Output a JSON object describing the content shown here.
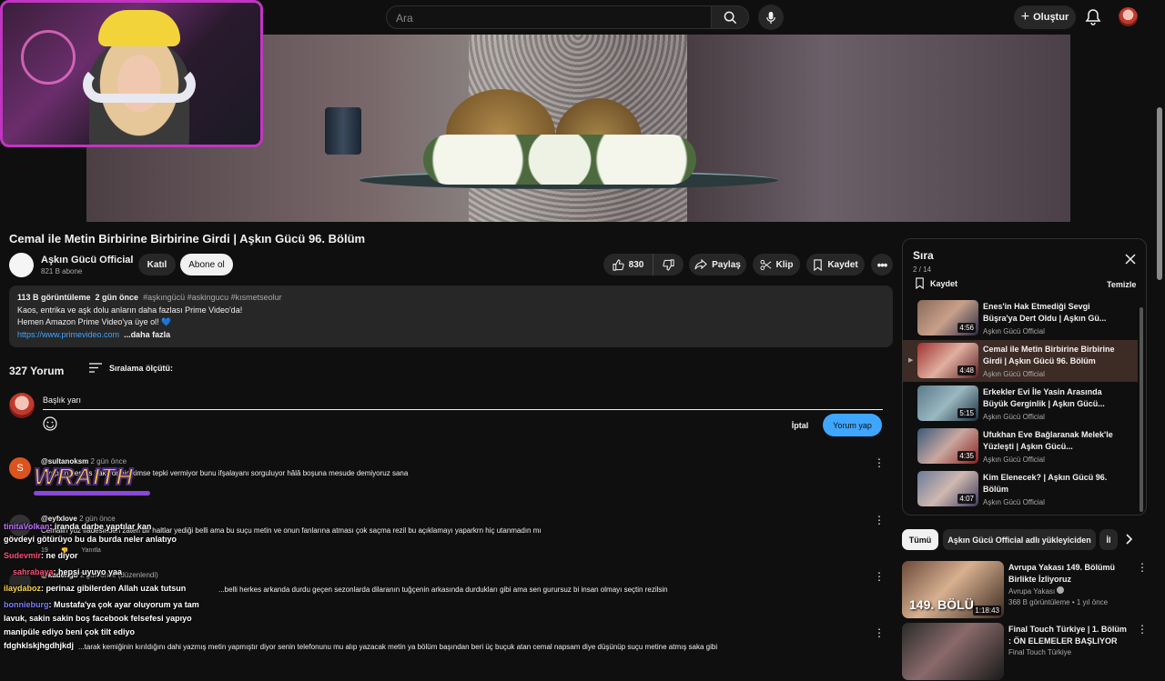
{
  "header": {
    "search_placeholder": "Ara",
    "create_label": "Oluştur"
  },
  "video": {
    "title": "Cemal ile Metin Birbirine Birbirine Girdi | Aşkın Gücü 96. Bölüm",
    "channel_name": "Aşkın Gücü Official",
    "subscribers": "821 B abone",
    "join_label": "Katıl",
    "subscribe_label": "Abone ol",
    "likes": "830",
    "share_label": "Paylaş",
    "clip_label": "Klip",
    "save_label": "Kaydet"
  },
  "description": {
    "views": "113 B görüntüleme",
    "date": "2 gün önce",
    "tags": "#aşkıngücü #askingucu #kısmetseolur",
    "line1": "Kaos, entrika ve aşk dolu anların daha fazlası Prime Video'da!",
    "line2": "Hemen Amazon Prime Video'ya üye ol! 💙",
    "link": "https://www.primevideo.com",
    "more": "...daha fazla"
  },
  "comments_section": {
    "count": "327 Yorum",
    "sort_label": "Sıralama ölçütü:",
    "input_value": "Başlık yarı",
    "cancel_label": "İptal",
    "submit_label": "Yorum yap",
    "reply_label": "Yanıtla",
    "items": [
      {
        "author": "@sultanoksm",
        "time": "2 gün önce",
        "avatar_letter": "S",
        "text": "...yapsın herkes bakıyor hiç kimse tepki vermiyor bunu ifşalayanı sorguluyor hâlâ boşuna mesude demiyoruz sana"
      },
      {
        "author": "@eyfxlove",
        "time": "2 gün önce",
        "text": "Cemalin yüz ifadesinden zaten bir haltlar yediği belli ama bu suçu metin ve onun fanlarına atması çok saçma rezil bu açıklamayı yaparkrn hiç utanmadın mı",
        "likes": "19"
      },
      {
        "author": "@kadengb",
        "time": "2 gün önce (düzenlendi)",
        "text": "...belli herkes arkanda durdu geçen sezonlarda dilaranın tuğçenin arkasında durdukları gibi ama sen gurursuz bi insan olmayı seçtin rezilsin"
      },
      {
        "author": "@",
        "time": "",
        "text": "...tarak kemiğinin kırıldığını dahi yazmış metin yapmıştır diyor senin telefonunu mu alıp yazacak metin ya bölüm başından beri üç buçuk atan  cemal  napsam diye düşünüp suçu metine atmış saka gibi"
      }
    ]
  },
  "overlay": {
    "brand": "WRAITH",
    "chat": [
      {
        "user": "tinitaVolkan",
        "msg": ": iranda darbe yaptılar kan"
      },
      {
        "user": "",
        "msg": "gövdeyi götürüyo bu da burda neler anlatıyo"
      },
      {
        "user": "Sudevmir",
        "msg": ": ne diyor"
      },
      {
        "user": "sahrabaya",
        "msg": ": hepsi uyuyo yaa"
      },
      {
        "user": "ilaydaboz",
        "msg": ": perinaz gibilerden Allah uzak tutsun"
      },
      {
        "user": "bonnieburg",
        "msg": ": Mustafa'ya çok ayar oluyorum ya tam"
      },
      {
        "user": "",
        "msg": "lavuk, sakin sakin boş facebook felsefesi yapıyo"
      },
      {
        "user": "",
        "msg": "manipüle ediyo beni çok tilt ediyo"
      },
      {
        "user": "fdghklskjhgdhjkdj",
        "msg": ""
      }
    ]
  },
  "playlist": {
    "title": "Sıra",
    "count": "2 / 14",
    "save_label": "Kaydet",
    "clear_label": "Temizle",
    "items": [
      {
        "title": "Enes'in Hak Etmediği Sevgi Büşra'ya Dert Oldu | Aşkın Gü...",
        "channel": "Aşkın Gücü Official",
        "duration": "4:56"
      },
      {
        "title": "Cemal ile Metin Birbirine Birbirine Girdi | Aşkın Gücü 96. Bölüm",
        "channel": "Aşkın Gücü Official",
        "duration": "4:48"
      },
      {
        "title": "Erkekler Evi İle Yasin Arasında Büyük Gerginlik | Aşkın Gücü...",
        "channel": "Aşkın Gücü Official",
        "duration": "5:15"
      },
      {
        "title": "Ufukhan Eve Bağlaranak Melek'le Yüzleşti | Aşkın Gücü...",
        "channel": "Aşkın Gücü Official",
        "duration": "4:35"
      },
      {
        "title": "Kim Elenecek? | Aşkın Gücü 96. Bölüm",
        "channel": "Aşkın Gücü Official",
        "duration": "4:07"
      }
    ]
  },
  "chips": [
    "Tümü",
    "Aşkın Gücü Official adlı yükleyiciden",
    "İl"
  ],
  "recommended": [
    {
      "title": "Avrupa Yakası 149. Bölümü Birlikte İzliyoruz",
      "channel": "Avrupa Yakası",
      "meta": "368 B görüntüleme • 1 yıl önce",
      "duration": "1:18:43",
      "badge": "149. BÖLÜ"
    },
    {
      "title": "Final Touch Türkiye | 1. Bölüm : ÖN ELEMELER BAŞLIYOR",
      "channel": "Final Touch Türkiye",
      "meta": "",
      "duration": ""
    }
  ]
}
